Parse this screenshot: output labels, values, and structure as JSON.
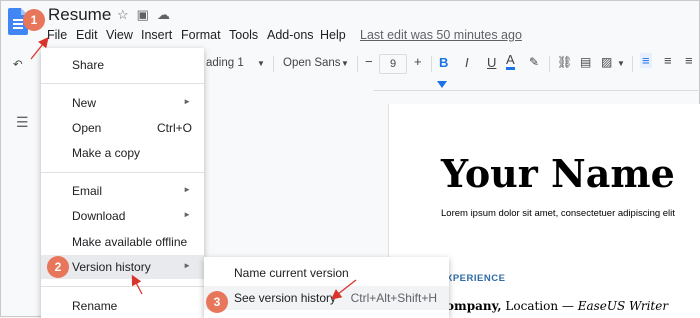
{
  "window": {
    "doc_title": "Resume",
    "last_edit": "Last edit was 50 minutes ago"
  },
  "title_icons": [
    "star-icon",
    "move-folder-icon",
    "cloud-status-icon"
  ],
  "menubar": [
    "File",
    "Edit",
    "View",
    "Insert",
    "Format",
    "Tools",
    "Add-ons",
    "Help"
  ],
  "toolbar": {
    "style": "ading 1",
    "font": "Open Sans",
    "font_size": "9",
    "minus": "−",
    "plus": "+"
  },
  "file_menu": {
    "share": "Share",
    "new": "New",
    "open": "Open",
    "open_shortcut": "Ctrl+O",
    "make_copy": "Make a copy",
    "email": "Email",
    "download": "Download",
    "offline": "Make available offline",
    "version_history": "Version history",
    "rename": "Rename"
  },
  "submenu": {
    "name_current": "Name current version",
    "see_history": "See version history",
    "see_history_shortcut": "Ctrl+Alt+Shift+H"
  },
  "document": {
    "name": "Your Name",
    "tagline": "Lorem ipsum dolor sit amet, consectetuer adipiscing elit",
    "section": "XPERIENCE",
    "company_bold": "ompany,",
    "company_rest": " Location — ",
    "company_italic": "EaseUS Writer"
  },
  "badges": [
    "1",
    "2",
    "3"
  ],
  "colors": {
    "accent": "#1a73e8",
    "badge": "#e8765a",
    "arrow": "#d9342b",
    "section": "#2f6ca6"
  }
}
